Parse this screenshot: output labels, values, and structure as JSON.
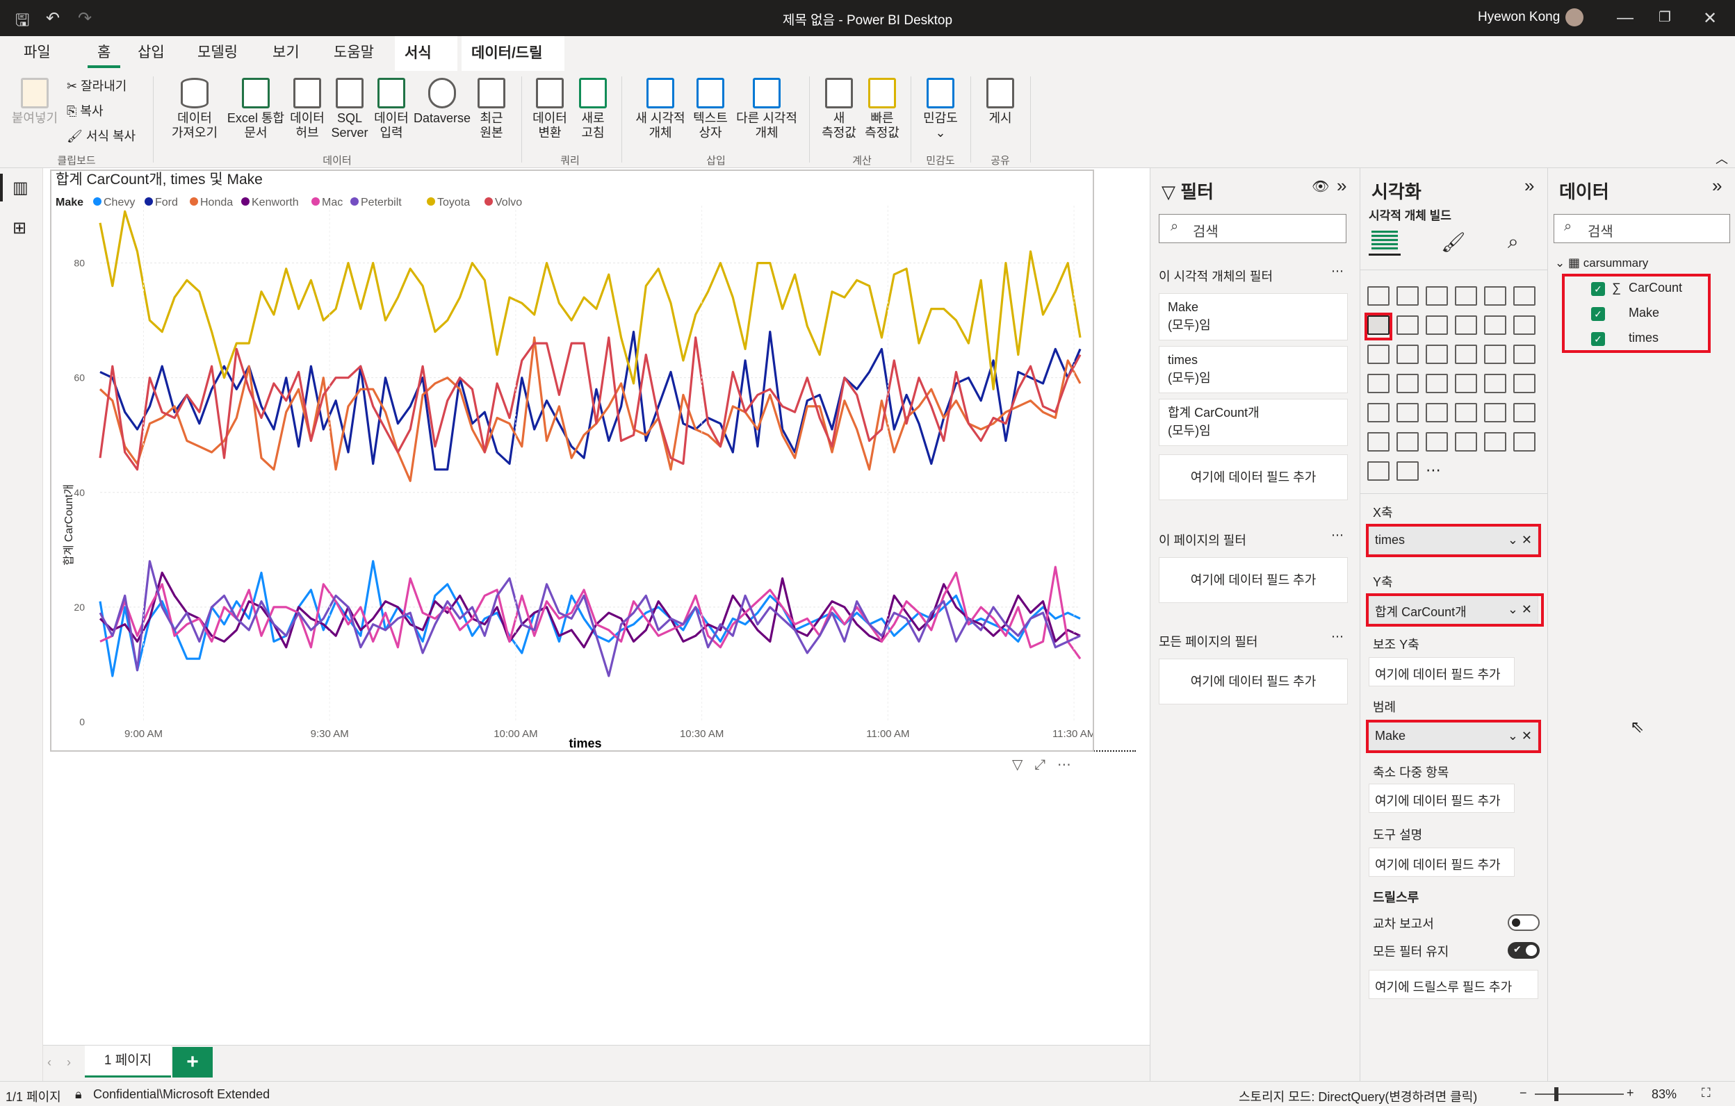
{
  "app": {
    "title": "제목 없음 - Power BI Desktop",
    "user": "Hyewon Kong"
  },
  "tabs": [
    {
      "label": "파일"
    },
    {
      "label": "홈"
    },
    {
      "label": "삽입"
    },
    {
      "label": "모델링"
    },
    {
      "label": "보기"
    },
    {
      "label": "도움말"
    },
    {
      "label": "서식"
    },
    {
      "label": "데이터/드릴"
    }
  ],
  "ribbon": {
    "paste": "붙여넣기",
    "cut": "잘라내기",
    "copy": "복사",
    "format_painter": "서식 복사",
    "clipboard_group": "클립보드",
    "get_data": "데이터\n가져오기",
    "excel": "Excel 통합\n문서",
    "data_hub": "데이터\n허브",
    "sql": "SQL\nServer",
    "enter_data": "데이터\n입력",
    "dataverse": "Dataverse",
    "recent": "최근\n원본",
    "data_group": "데이터",
    "transform": "데이터\n변환",
    "refresh": "새로\n고침",
    "query_group": "쿼리",
    "new_visual": "새 시각적\n개체",
    "textbox": "텍스트\n상자",
    "more_visuals": "다른 시각적\n개체",
    "insert_group": "삽입",
    "new_measure": "새\n측정값",
    "quick_measure": "빠른\n측정값",
    "calc_group": "계산",
    "sensitivity": "민감도",
    "sensitivity_group": "민감도",
    "publish": "게시",
    "share_group": "공유"
  },
  "chart": {
    "title": "합계 CarCount개, times 및 Make",
    "legend_title": "Make",
    "xlabel": "times",
    "ylabel": "합계 CarCount개"
  },
  "chart_data": {
    "type": "line",
    "title": "합계 CarCount개, times 및 Make",
    "xlabel": "times",
    "ylabel": "합계 CarCount개",
    "ylim": [
      0,
      90
    ],
    "y_ticks": [
      0,
      20,
      40,
      60,
      80
    ],
    "x_ticks": [
      "9:00 AM",
      "9:30 AM",
      "10:00 AM",
      "10:30 AM",
      "11:00 AM",
      "11:30 AM"
    ],
    "x": [
      "8:53",
      "8:55",
      "8:57",
      "8:59",
      "9:01",
      "9:03",
      "9:05",
      "9:07",
      "9:09",
      "9:11",
      "9:13",
      "9:15",
      "9:17",
      "9:19",
      "9:21",
      "9:23",
      "9:25",
      "9:27",
      "9:29",
      "9:31",
      "9:33",
      "9:35",
      "9:37",
      "9:39",
      "9:41",
      "9:43",
      "9:45",
      "9:47",
      "9:49",
      "9:51",
      "9:53",
      "9:55",
      "9:57",
      "9:59",
      "10:01",
      "10:03",
      "10:05",
      "10:07",
      "10:09",
      "10:11",
      "10:13",
      "10:15",
      "10:17",
      "10:19",
      "10:21",
      "10:23",
      "10:25",
      "10:27",
      "10:29",
      "10:31",
      "10:33",
      "10:35",
      "10:37",
      "10:39",
      "10:41",
      "10:43",
      "10:45",
      "10:47",
      "10:49",
      "10:51",
      "10:53",
      "10:55",
      "10:57",
      "10:59",
      "11:01",
      "11:03",
      "11:05",
      "11:07",
      "11:09",
      "11:11",
      "11:13",
      "11:15",
      "11:17",
      "11:19",
      "11:21",
      "11:23",
      "11:25",
      "11:27",
      "11:29",
      "11:31"
    ],
    "grid": true,
    "legend_position": "top-left",
    "series": [
      {
        "name": "Chevy",
        "color": "#118dff",
        "values": [
          21,
          8,
          20,
          9,
          18,
          21,
          16,
          11,
          11,
          20,
          17,
          21,
          18,
          26,
          14,
          15,
          20,
          23,
          16,
          21,
          18,
          15,
          28,
          16,
          20,
          18,
          14,
          22,
          24,
          20,
          15,
          18,
          19,
          15,
          12,
          19,
          20,
          14,
          22,
          18,
          15,
          14,
          16,
          17,
          19,
          20,
          18,
          16,
          20,
          17,
          14,
          18,
          17,
          19,
          22,
          20,
          16,
          17,
          18,
          19,
          17,
          19,
          17,
          18,
          15,
          17,
          19,
          18,
          20,
          22,
          17,
          18,
          17,
          16,
          14,
          18,
          20,
          18,
          19,
          18
        ]
      },
      {
        "name": "Ford",
        "color": "#12239e",
        "values": [
          61,
          60,
          54,
          51,
          55,
          62,
          54,
          57,
          52,
          58,
          62,
          58,
          62,
          55,
          51,
          60,
          48,
          62,
          51,
          56,
          47,
          62,
          45,
          60,
          52,
          55,
          60,
          44,
          44,
          60,
          52,
          54,
          47,
          45,
          60,
          51,
          56,
          52,
          48,
          46,
          58,
          49,
          55,
          68,
          49,
          55,
          61,
          52,
          51,
          53,
          52,
          47,
          63,
          48,
          68,
          51,
          47,
          56,
          57,
          51,
          60,
          58,
          61,
          65,
          51,
          57,
          52,
          45,
          53,
          59,
          60,
          56,
          63,
          49,
          61,
          60,
          59,
          65,
          60,
          65
        ]
      },
      {
        "name": "Honda",
        "color": "#e66c37",
        "values": [
          58,
          56,
          48,
          45,
          52,
          53,
          55,
          49,
          48,
          47,
          49,
          53,
          62,
          46,
          44,
          54,
          58,
          49,
          60,
          44,
          55,
          58,
          58,
          54,
          47,
          42,
          57,
          59,
          60,
          58,
          51,
          47,
          53,
          52,
          48,
          67,
          49,
          55,
          46,
          50,
          52,
          55,
          59,
          51,
          50,
          53,
          44,
          57,
          51,
          50,
          48,
          55,
          54,
          51,
          57,
          50,
          46,
          55,
          55,
          47,
          56,
          51,
          44,
          56,
          47,
          53,
          55,
          58,
          53,
          56,
          52,
          51,
          52,
          54,
          55,
          56,
          54,
          53,
          63,
          59
        ]
      },
      {
        "name": "Kenworth",
        "color": "#6b007b",
        "values": [
          18,
          16,
          17,
          14,
          18,
          26,
          22,
          19,
          18,
          15,
          14,
          16,
          21,
          20,
          17,
          13,
          20,
          18,
          17,
          15,
          20,
          16,
          18,
          21,
          20,
          17,
          16,
          21,
          19,
          22,
          18,
          17,
          20,
          14,
          17,
          19,
          20,
          15,
          16,
          13,
          17,
          19,
          18,
          14,
          16,
          21,
          18,
          14,
          15,
          17,
          16,
          22,
          19,
          16,
          14,
          25,
          16,
          15,
          18,
          21,
          20,
          17,
          15,
          14,
          22,
          19,
          16,
          18,
          24,
          20,
          18,
          17,
          15,
          17,
          22,
          19,
          21,
          14,
          16,
          15
        ]
      },
      {
        "name": "Mac",
        "color": "#e044a7",
        "values": [
          14,
          15,
          21,
          15,
          20,
          24,
          15,
          17,
          18,
          14,
          20,
          18,
          23,
          15,
          20,
          20,
          19,
          13,
          24,
          21,
          17,
          20,
          14,
          19,
          13,
          25,
          19,
          18,
          20,
          16,
          18,
          22,
          23,
          14,
          22,
          15,
          21,
          18,
          19,
          23,
          17,
          16,
          14,
          21,
          18,
          15,
          16,
          17,
          22,
          15,
          13,
          17,
          19,
          21,
          23,
          20,
          17,
          18,
          15,
          20,
          17,
          20,
          17,
          14,
          17,
          21,
          19,
          16,
          22,
          26,
          17,
          20,
          18,
          15,
          20,
          13,
          14,
          27,
          14,
          11
        ]
      },
      {
        "name": "Peterbilt",
        "color": "#744ec2",
        "values": [
          19,
          15,
          22,
          9,
          28,
          20,
          16,
          19,
          14,
          20,
          22,
          18,
          16,
          21,
          17,
          15,
          19,
          16,
          18,
          22,
          20,
          13,
          17,
          16,
          18,
          19,
          12,
          17,
          21,
          18,
          20,
          15,
          22,
          25,
          17,
          16,
          24,
          19,
          18,
          22,
          15,
          8,
          17,
          19,
          22,
          16,
          18,
          17,
          20,
          13,
          17,
          15,
          22,
          17,
          20,
          18,
          16,
          12,
          15,
          19,
          14,
          21,
          17,
          15,
          19,
          18,
          14,
          19,
          21,
          14,
          18,
          16,
          20,
          17,
          15,
          18,
          19,
          13,
          14,
          15
        ]
      },
      {
        "name": "Toyota",
        "color": "#d9b300",
        "values": [
          87,
          76,
          89,
          82,
          70,
          68,
          74,
          77,
          75,
          68,
          60,
          66,
          66,
          75,
          71,
          79,
          72,
          77,
          70,
          72,
          80,
          72,
          80,
          70,
          74,
          79,
          76,
          68,
          70,
          74,
          80,
          77,
          64,
          74,
          73,
          71,
          80,
          73,
          70,
          74,
          72,
          78,
          67,
          59,
          76,
          79,
          73,
          63,
          71,
          75,
          80,
          74,
          65,
          80,
          80,
          72,
          78,
          69,
          64,
          75,
          74,
          77,
          76,
          67,
          78,
          79,
          66,
          72,
          72,
          70,
          66,
          77,
          58,
          80,
          64,
          82,
          71,
          75,
          80,
          67
        ]
      },
      {
        "name": "Volvo",
        "color": "#d64550",
        "values": [
          46,
          62,
          47,
          44,
          60,
          54,
          53,
          57,
          54,
          62,
          46,
          65,
          58,
          53,
          59,
          56,
          61,
          49,
          57,
          60,
          60,
          62,
          55,
          51,
          47,
          51,
          62,
          48,
          56,
          60,
          58,
          47,
          59,
          53,
          63,
          66,
          66,
          57,
          66,
          66,
          52,
          67,
          49,
          50,
          64,
          53,
          46,
          45,
          67,
          52,
          48,
          61,
          54,
          57,
          58,
          55,
          54,
          60,
          53,
          48,
          60,
          57,
          49,
          51,
          63,
          52,
          60,
          55,
          49,
          61,
          52,
          49,
          53,
          52,
          58,
          62,
          55,
          54,
          60,
          64
        ]
      }
    ]
  },
  "filters": {
    "title": "필터",
    "search_placeholder": "검색",
    "visual_section": "이 시각적 개체의 필터",
    "cards": [
      {
        "field": "Make",
        "state": "(모두)임"
      },
      {
        "field": "times",
        "state": "(모두)임"
      },
      {
        "field": "합계 CarCount개",
        "state": "(모두)임"
      }
    ],
    "add_field": "여기에 데이터 필드 추가",
    "page_section": "이 페이지의 필터",
    "all_pages_section": "모든 페이지의 필터"
  },
  "viz": {
    "title": "시각화",
    "build_label": "시각적 개체 빌드",
    "x_axis_label": "X축",
    "x_axis_field": "times",
    "y_axis_label": "Y축",
    "y_axis_field": "합계 CarCount개",
    "secondary_y_label": "보조 Y축",
    "legend_label": "범례",
    "legend_field": "Make",
    "small_multiples_label": "축소 다중 항목",
    "tooltips_label": "도구 설명",
    "add_field": "여기에 데이터 필드 추가",
    "drillthrough_label": "드릴스루",
    "cross_report_label": "교차 보고서",
    "keep_filters_label": "모든 필터 유지",
    "drillthrough_add": "여기에 드릴스루 필드 추가"
  },
  "data_pane": {
    "title": "데이터",
    "search_placeholder": "검색",
    "table": "carsummary",
    "fields": [
      {
        "name": "CarCount",
        "sigma": "∑"
      },
      {
        "name": "Make",
        "sigma": ""
      },
      {
        "name": "times",
        "sigma": ""
      }
    ]
  },
  "pages": {
    "current": "1 페이지",
    "add": "+"
  },
  "status": {
    "page_count": "1/1 페이지",
    "sensitivity": "Confidential\\Microsoft Extended",
    "storage_mode": "스토리지 모드: DirectQuery(변경하려면 클릭)",
    "zoom": "83%"
  }
}
